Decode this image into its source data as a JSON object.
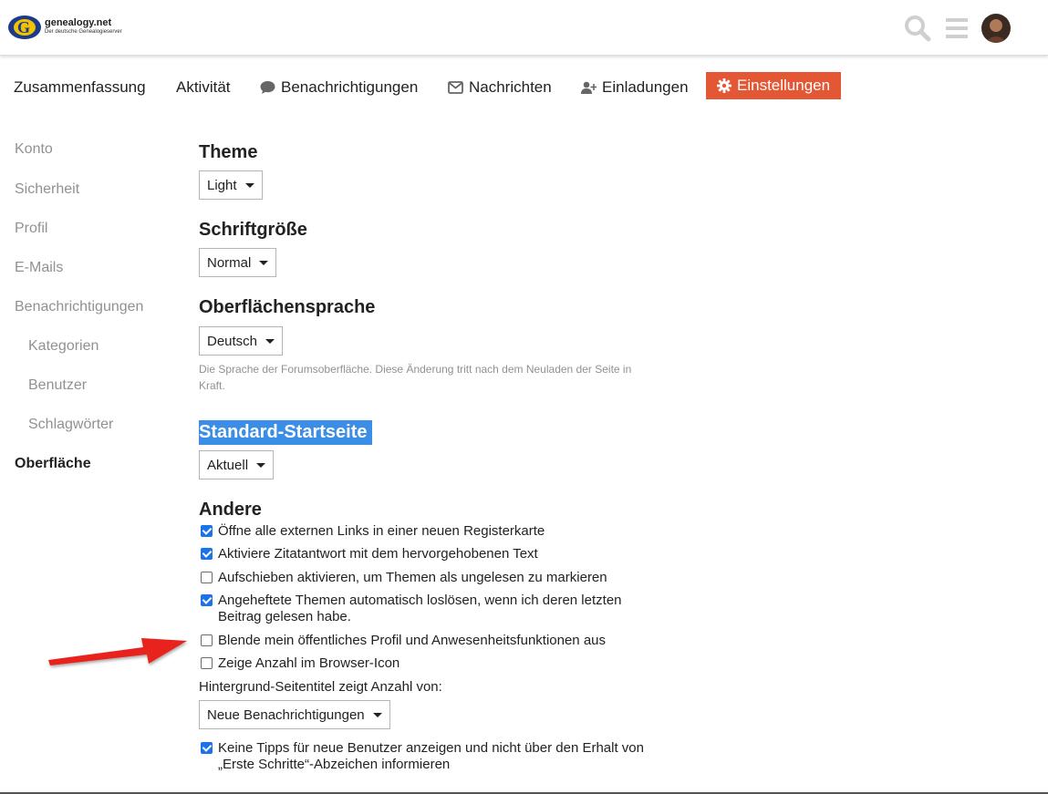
{
  "header": {
    "logo_name": "genealogy.net",
    "logo_tagline": "Der deutsche Genealogieserver",
    "icons": [
      "search-icon",
      "hamburger-menu-icon",
      "avatar"
    ]
  },
  "nav": {
    "items": [
      {
        "label": "Zusammenfassung",
        "icon": ""
      },
      {
        "label": "Aktivität",
        "icon": ""
      },
      {
        "label": "Benachrichtigungen",
        "icon": "speech-bubble-icon"
      },
      {
        "label": "Nachrichten",
        "icon": "envelope-icon"
      },
      {
        "label": "Einladungen",
        "icon": "user-plus-icon"
      },
      {
        "label": "Einstellungen",
        "icon": "gear-icon",
        "active": true
      }
    ],
    "accent_color": "#e45735"
  },
  "sidebar": {
    "items": [
      {
        "label": "Konto"
      },
      {
        "label": "Sicherheit"
      },
      {
        "label": "Profil"
      },
      {
        "label": "E-Mails"
      },
      {
        "label": "Benachrichtigungen"
      },
      {
        "label": "Kategorien",
        "sub": true
      },
      {
        "label": "Benutzer",
        "sub": true
      },
      {
        "label": "Schlagwörter",
        "sub": true
      },
      {
        "label": "Oberfläche",
        "active": true
      }
    ]
  },
  "main": {
    "theme": {
      "title": "Theme",
      "value": "Light"
    },
    "font_size": {
      "title": "Schriftgröße",
      "value": "Normal"
    },
    "language": {
      "title": "Oberflächensprache",
      "value": "Deutsch",
      "help": "Die Sprache der Forumsoberfläche. Diese Änderung tritt nach dem Neuladen der Seite in Kraft."
    },
    "homepage": {
      "title": "Standard-Startseite",
      "value": "Aktuell"
    },
    "other": {
      "title": "Andere",
      "options": [
        {
          "label": "Öffne alle externen Links in einer neuen Registerkarte",
          "checked": true
        },
        {
          "label": "Aktiviere Zitatantwort mit dem hervorgehobenen Text",
          "checked": true
        },
        {
          "label": "Aufschieben aktivieren, um Themen als ungelesen zu markieren",
          "checked": false
        },
        {
          "label": "Angeheftete Themen automatisch loslösen, wenn ich deren letzten Beitrag gelesen habe.",
          "checked": true
        },
        {
          "label": "Blende mein öffentliches Profil und Anwesenheitsfunktionen aus",
          "checked": false
        },
        {
          "label": "Zeige Anzahl im Browser-Icon",
          "checked": false
        }
      ],
      "title_count_label": "Hintergrund-Seitentitel zeigt Anzahl von:",
      "title_count_value": "Neue Benachrichtigungen",
      "tips_option": {
        "label": "Keine Tipps für neue Benutzer anzeigen und nicht über den Erhalt von „Erste Schritte“-Abzeichen informieren",
        "checked": true
      }
    }
  },
  "annotation": {
    "type": "red-arrow",
    "color": "#e8231f"
  }
}
